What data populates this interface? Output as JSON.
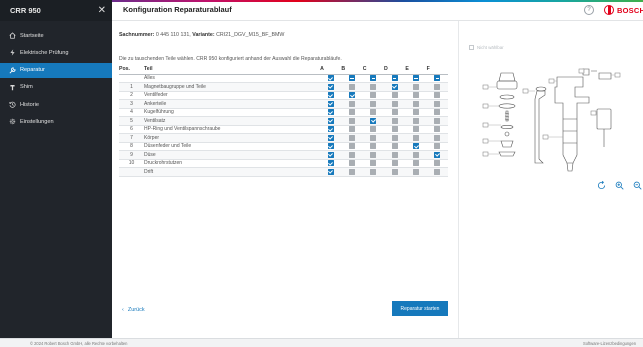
{
  "sidebar": {
    "title": "CRR 950",
    "items": [
      {
        "label": "Startseite",
        "icon": "home-icon",
        "active": false
      },
      {
        "label": "Elektrische Prüfung",
        "icon": "lightning-icon",
        "active": false
      },
      {
        "label": "Reparatur",
        "icon": "wrench-icon",
        "active": true
      },
      {
        "label": "Shim",
        "icon": "shim-icon",
        "active": false
      },
      {
        "label": "Historie",
        "icon": "history-icon",
        "active": false
      },
      {
        "label": "Einstellungen",
        "icon": "gear-icon",
        "active": false
      }
    ]
  },
  "header": {
    "title": "Konfiguration Reparaturablauf",
    "brand": "BOSCH",
    "help_icon": "help-icon",
    "brand_color": "#e2001a"
  },
  "main": {
    "sachnummer_label": "Sachnummer:",
    "sachnummer_value": "0 445 110 131,",
    "variante_label": "Variante:",
    "variante_value": "CRI21_DGV_M15_BF_BMW",
    "instruction": "Die zu tauschenden Teile wählen. CRR 950 konfiguriert anhand der Auswahl die Reparaturabläufe.",
    "columns": {
      "pos": "Pos.",
      "teil": "Teil",
      "checks": [
        "A",
        "B",
        "C",
        "D",
        "E",
        "F"
      ]
    },
    "rows": [
      {
        "pos": "",
        "teil": "Alles",
        "checks": [
          "on",
          "ind",
          "ind",
          "ind",
          "ind",
          "ind"
        ]
      },
      {
        "pos": "1",
        "teil": "Magnetbaugruppe und Teile",
        "checks": [
          "on",
          "off",
          "off",
          "on",
          "off",
          "off"
        ]
      },
      {
        "pos": "2",
        "teil": "Ventilfeder",
        "checks": [
          "on",
          "on",
          "off",
          "off",
          "off",
          "off"
        ]
      },
      {
        "pos": "3",
        "teil": "Ankerteile",
        "checks": [
          "on",
          "off",
          "off",
          "off",
          "off",
          "off"
        ]
      },
      {
        "pos": "4",
        "teil": "Kugelführung",
        "checks": [
          "on",
          "off",
          "off",
          "off",
          "off",
          "off"
        ]
      },
      {
        "pos": "5",
        "teil": "Ventilsatz",
        "checks": [
          "on",
          "off",
          "on",
          "off",
          "off",
          "off"
        ]
      },
      {
        "pos": "6",
        "teil": "HP-Ring und Ventilspannschraube",
        "checks": [
          "on",
          "off",
          "off",
          "off",
          "off",
          "off"
        ]
      },
      {
        "pos": "7",
        "teil": "Körper",
        "checks": [
          "on",
          "off",
          "off",
          "off",
          "off",
          "off"
        ]
      },
      {
        "pos": "8",
        "teil": "Düsenfeder und Teile",
        "checks": [
          "on",
          "off",
          "off",
          "off",
          "on",
          "off"
        ]
      },
      {
        "pos": "9",
        "teil": "Düse",
        "checks": [
          "on",
          "off",
          "off",
          "off",
          "off",
          "on"
        ]
      },
      {
        "pos": "10",
        "teil": "Druckrohrstutzen",
        "checks": [
          "on",
          "off",
          "off",
          "off",
          "off",
          "off"
        ]
      },
      {
        "pos": "",
        "teil": "Drift",
        "checks": [
          "on",
          "off",
          "off",
          "off",
          "off",
          "off"
        ]
      }
    ],
    "back_label": "Zurück",
    "start_label": "Reparatur starten",
    "accent_color": "#1679bc"
  },
  "right_panel": {
    "not_selectable": "Nicht wählbar",
    "diagram_icon": "injector-exploded-view",
    "tools": [
      "rotate-icon",
      "zoom-in-icon",
      "zoom-out-icon"
    ]
  },
  "footer": {
    "copyright": "© 2024 Robert Bosch GmbH, alle Rechte vorbehalten",
    "license": "Software-Lizenzbedingungen"
  }
}
